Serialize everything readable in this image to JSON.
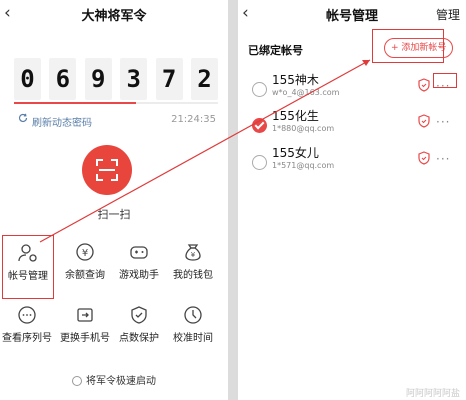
{
  "left": {
    "title": "大神将军令",
    "back_glyph": "‹",
    "digits": [
      "0",
      "6",
      "9",
      "3",
      "7",
      "2"
    ],
    "progress": 0.6,
    "refresh_label": "刷新动态密码",
    "timer": "21:24:35",
    "scan_label": "扫一扫",
    "grid": [
      {
        "label": "帐号管理",
        "icon": "account-manage-icon"
      },
      {
        "label": "余额查询",
        "icon": "balance-icon"
      },
      {
        "label": "游戏助手",
        "icon": "gamepad-icon"
      },
      {
        "label": "我的钱包",
        "icon": "wallet-icon"
      },
      {
        "label": "查看序列号",
        "icon": "serial-icon"
      },
      {
        "label": "更换手机号",
        "icon": "phone-icon"
      },
      {
        "label": "点数保护",
        "icon": "shield-icon"
      },
      {
        "label": "校准时间",
        "icon": "clock-icon"
      }
    ],
    "quick_start": "将军令极速启动"
  },
  "right": {
    "title": "帐号管理",
    "back_glyph": "‹",
    "manage_label": "管理",
    "bound_title": "已绑定帐号",
    "add_label": "+ 添加新帐号",
    "accounts": [
      {
        "name": "155神木",
        "sub": "w*o_4@163.com",
        "selected": false
      },
      {
        "name": "155化生",
        "sub": "1*880@qq.com",
        "selected": true
      },
      {
        "name": "155女儿",
        "sub": "1*571@qq.com",
        "selected": false
      }
    ],
    "more_glyph": "···",
    "watermark": "阿阿阿阿阿盐"
  },
  "colors": {
    "accent": "#e84848",
    "annotation": "#e03b3b"
  }
}
